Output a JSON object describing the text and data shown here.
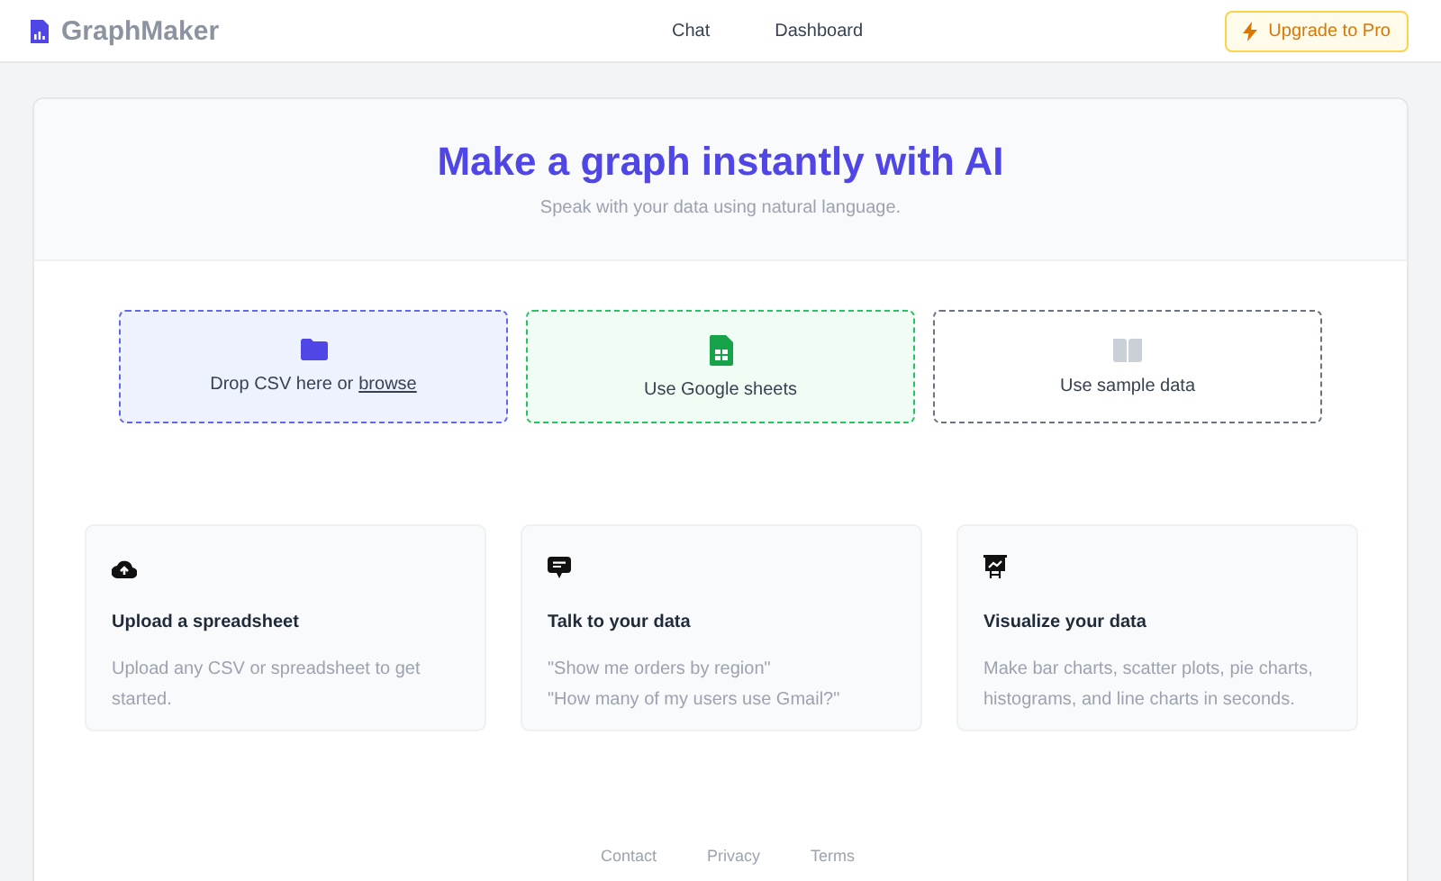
{
  "header": {
    "brand": "GraphMaker",
    "nav": [
      "Chat",
      "Dashboard"
    ],
    "upgrade_button": "Upgrade to Pro"
  },
  "hero": {
    "title": "Make a graph instantly with AI",
    "subtitle": "Speak with your data using natural language."
  },
  "sources": [
    {
      "kind": "upload",
      "label": "Drop CSV here or",
      "link": "browse"
    },
    {
      "kind": "sheets",
      "label": "Use Google sheets"
    },
    {
      "kind": "sample",
      "label": "Use sample data"
    }
  ],
  "features": [
    {
      "kind": "upload",
      "title": "Upload a spreadsheet",
      "lines": [
        "Upload any CSV or spreadsheet to get started."
      ]
    },
    {
      "kind": "chat",
      "title": "Talk to your data",
      "lines": [
        "\"Show me orders by region\"",
        "\"How many of my users use Gmail?\""
      ]
    },
    {
      "kind": "chart",
      "title": "Visualize your data",
      "lines": [
        "Make bar charts, scatter plots, pie charts, histograms, and line charts in seconds."
      ]
    }
  ],
  "footer": [
    "Contact",
    "Privacy",
    "Terms"
  ]
}
